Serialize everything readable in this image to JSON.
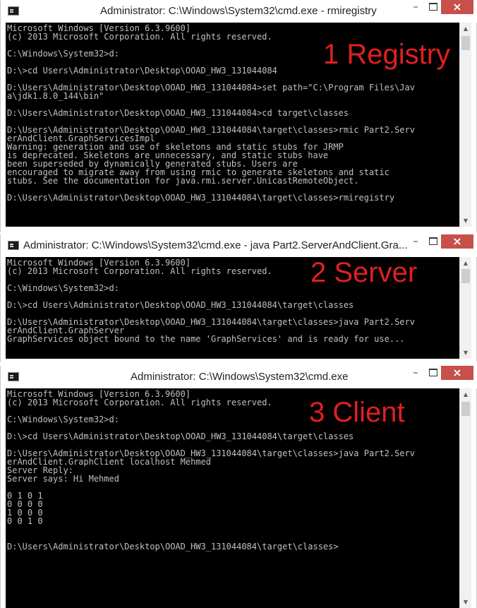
{
  "windows": [
    {
      "title": "Administrator: C:\\Windows\\System32\\cmd.exe - rmiregistry",
      "label": "1 Registry",
      "lines": [
        "Microsoft Windows [Version 6.3.9600]",
        "(c) 2013 Microsoft Corporation. All rights reserved.",
        "",
        "C:\\Windows\\System32>d:",
        "",
        "D:\\>cd Users\\Administrator\\Desktop\\OOAD_HW3_131044084",
        "",
        "D:\\Users\\Administrator\\Desktop\\OOAD_HW3_131044084>set path=\"C:\\Program Files\\Jav",
        "a\\jdk1.8.0_144\\bin\"",
        "",
        "D:\\Users\\Administrator\\Desktop\\OOAD_HW3_131044084>cd target\\classes",
        "",
        "D:\\Users\\Administrator\\Desktop\\OOAD_HW3_131044084\\target\\classes>rmic Part2.Serv",
        "erAndClient.GraphServicesImpl",
        "Warning: generation and use of skeletons and static stubs for JRMP",
        "is deprecated. Skeletons are unnecessary, and static stubs have",
        "been superseded by dynamically generated stubs. Users are",
        "encouraged to migrate away from using rmic to generate skeletons and static",
        "stubs. See the documentation for java.rmi.server.UnicastRemoteObject.",
        "",
        "D:\\Users\\Administrator\\Desktop\\OOAD_HW3_131044084\\target\\classes>rmiregistry"
      ]
    },
    {
      "title": "Administrator: C:\\Windows\\System32\\cmd.exe - java  Part2.ServerAndClient.Gra...",
      "label": "2 Server",
      "lines": [
        "Microsoft Windows [Version 6.3.9600]",
        "(c) 2013 Microsoft Corporation. All rights reserved.",
        "",
        "C:\\Windows\\System32>d:",
        "",
        "D:\\>cd Users\\Administrator\\Desktop\\OOAD_HW3_131044084\\target\\classes",
        "",
        "D:\\Users\\Administrator\\Desktop\\OOAD_HW3_131044084\\target\\classes>java Part2.Serv",
        "erAndClient.GraphServer",
        "GraphServices object bound to the name 'GraphServices' and is ready for use..."
      ]
    },
    {
      "title": "Administrator: C:\\Windows\\System32\\cmd.exe",
      "label": "3 Client",
      "lines": [
        "Microsoft Windows [Version 6.3.9600]",
        "(c) 2013 Microsoft Corporation. All rights reserved.",
        "",
        "C:\\Windows\\System32>d:",
        "",
        "D:\\>cd Users\\Administrator\\Desktop\\OOAD_HW3_131044084\\target\\classes",
        "",
        "D:\\Users\\Administrator\\Desktop\\OOAD_HW3_131044084\\target\\classes>java Part2.Serv",
        "erAndClient.GraphClient localhost Mehmed",
        "Server Reply:",
        "Server says: Hi Mehmed",
        "",
        "0 1 0 1",
        "0 0 0 0",
        "1 0 0 0",
        "0 0 1 0",
        "",
        "",
        "D:\\Users\\Administrator\\Desktop\\OOAD_HW3_131044084\\target\\classes>"
      ]
    }
  ],
  "icons": {
    "app": "cmd-icon",
    "minimize": "minimize-icon",
    "maximize": "maximize-icon",
    "close": "close-icon"
  },
  "colors": {
    "console_bg": "#000000",
    "console_text": "#c0c0c0",
    "label_red": "#e02020",
    "close_button": "#c7504a"
  }
}
